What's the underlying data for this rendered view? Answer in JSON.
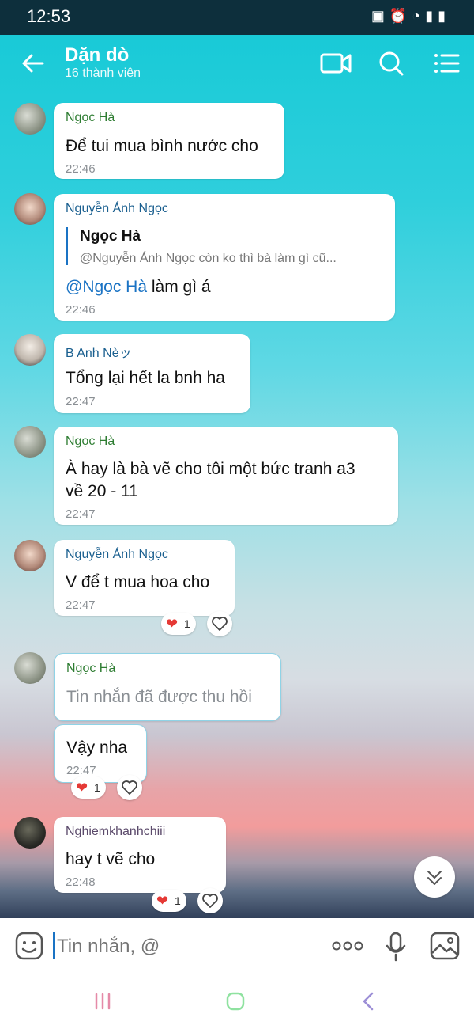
{
  "status_bar": {
    "time": "12:53"
  },
  "header": {
    "title": "Dặn dò",
    "subtitle": "16 thành viên"
  },
  "messages": [
    {
      "sender": "Ngọc Hà",
      "text": "Để tui mua bình nước cho",
      "time": "22:46"
    },
    {
      "sender": "Nguyễn Ánh Ngọc",
      "quote_name": "Ngọc Hà",
      "quote_text": "@Nguyễn Ánh Ngọc còn ko thì bà làm gì cũ...",
      "mention": "@Ngọc Hà",
      "text": " làm gì á",
      "time": "22:46"
    },
    {
      "sender": "B Anh Nèッ",
      "text": "Tổng lại hết la bnh ha",
      "time": "22:47"
    },
    {
      "sender": "Ngọc Hà",
      "text_line1": "À hay là bà vẽ cho tôi một bức tranh a3",
      "text_line2": "về 20 - 11",
      "time": "22:47"
    },
    {
      "sender": "Nguyễn Ánh Ngọc",
      "text": "V để t mua hoa cho",
      "time": "22:47",
      "reaction_count": "1"
    },
    {
      "sender": "Ngọc Hà",
      "text": "Tin nhắn đã được thu hồi"
    },
    {
      "text": "Vậy nha",
      "time": "22:47",
      "reaction_count": "1"
    },
    {
      "sender": "Nghiemkhanhchiii",
      "text": "hay t vẽ cho",
      "time": "22:48",
      "reaction_count": "1"
    }
  ],
  "composer": {
    "placeholder": "Tin nhắn, @"
  },
  "colors": {
    "sender_green": "#2e7d32",
    "sender_blue": "#1a5f8f",
    "mention_blue": "#1a73c4",
    "heart_red": "#e53935"
  }
}
